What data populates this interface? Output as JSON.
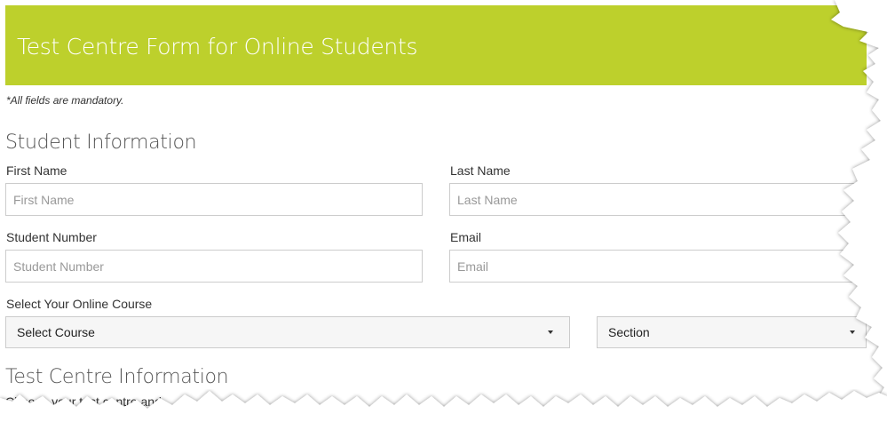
{
  "header": {
    "title": "Test Centre Form for Online Students"
  },
  "note": "*All fields are mandatory.",
  "student_section": {
    "heading": "Student Information",
    "first_name": {
      "label": "First Name",
      "placeholder": "First Name"
    },
    "last_name": {
      "label": "Last Name",
      "placeholder": "Last Name"
    },
    "student_number": {
      "label": "Student Number",
      "placeholder": "Student Number"
    },
    "email": {
      "label": "Email",
      "placeholder": "Email"
    },
    "course": {
      "label": "Select Your Online Course",
      "select_value": "Select Course",
      "section_value": "Section"
    }
  },
  "test_centre_section": {
    "heading": "Test Centre Information",
    "partial_text": "Choose your test centre and..."
  },
  "colors": {
    "banner": "#bdd02c",
    "banner_text": "#ffffff"
  }
}
